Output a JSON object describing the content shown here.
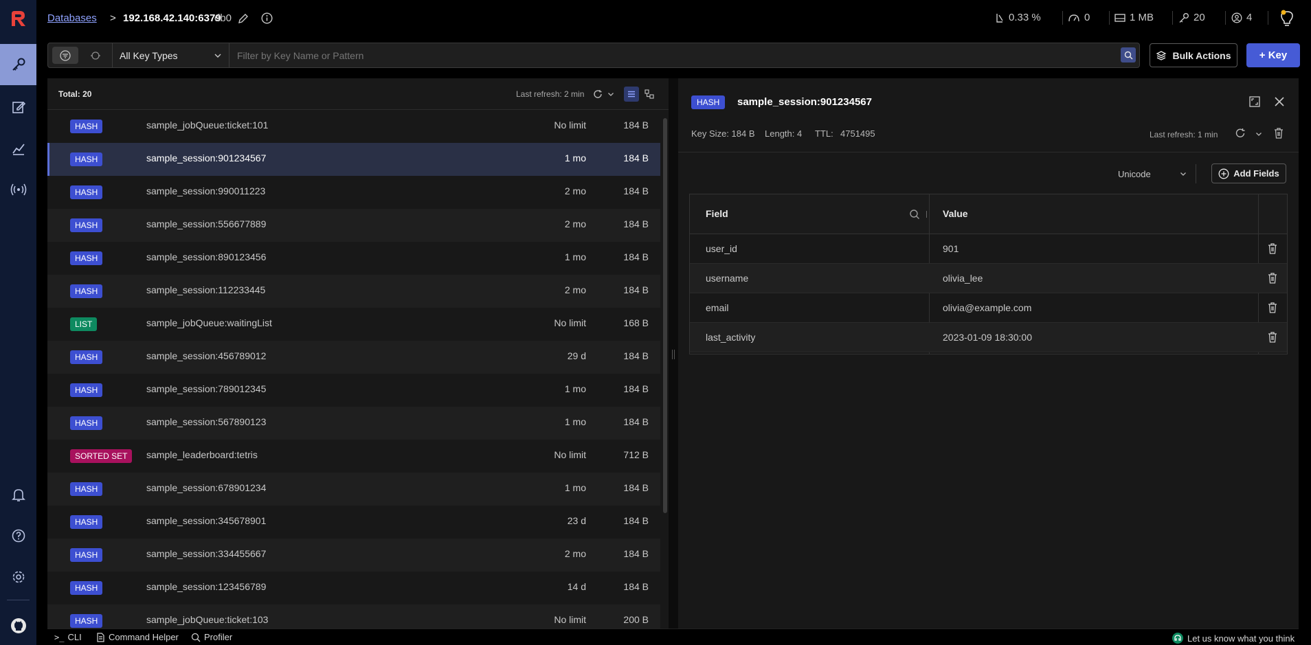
{
  "topbar": {
    "databases_link": "Databases",
    "separator": ">",
    "host": "192.168.42.140:6379",
    "db": "db0",
    "stats": {
      "cpu": "0.33 %",
      "ops": "0",
      "memory": "1 MB",
      "keys": "20",
      "clients": "4"
    }
  },
  "filter": {
    "key_type": "All Key Types",
    "search_placeholder": "Filter by Key Name or Pattern",
    "bulk_actions": "Bulk Actions",
    "add_key": "+ Key"
  },
  "keylist": {
    "total": "Total: 20",
    "last_refresh": "Last refresh: 2 min",
    "rows": [
      {
        "type": "HASH",
        "name": "sample_jobQueue:ticket:101",
        "ttl": "No limit",
        "size": "184 B"
      },
      {
        "type": "HASH",
        "name": "sample_session:901234567",
        "ttl": "1 mo",
        "size": "184 B"
      },
      {
        "type": "HASH",
        "name": "sample_session:990011223",
        "ttl": "2 mo",
        "size": "184 B"
      },
      {
        "type": "HASH",
        "name": "sample_session:556677889",
        "ttl": "2 mo",
        "size": "184 B"
      },
      {
        "type": "HASH",
        "name": "sample_session:890123456",
        "ttl": "1 mo",
        "size": "184 B"
      },
      {
        "type": "HASH",
        "name": "sample_session:112233445",
        "ttl": "2 mo",
        "size": "184 B"
      },
      {
        "type": "LIST",
        "name": "sample_jobQueue:waitingList",
        "ttl": "No limit",
        "size": "168 B"
      },
      {
        "type": "HASH",
        "name": "sample_session:456789012",
        "ttl": "29 d",
        "size": "184 B"
      },
      {
        "type": "HASH",
        "name": "sample_session:789012345",
        "ttl": "1 mo",
        "size": "184 B"
      },
      {
        "type": "HASH",
        "name": "sample_session:567890123",
        "ttl": "1 mo",
        "size": "184 B"
      },
      {
        "type": "SORTED SET",
        "name": "sample_leaderboard:tetris",
        "ttl": "No limit",
        "size": "712 B"
      },
      {
        "type": "HASH",
        "name": "sample_session:678901234",
        "ttl": "1 mo",
        "size": "184 B"
      },
      {
        "type": "HASH",
        "name": "sample_session:345678901",
        "ttl": "23 d",
        "size": "184 B"
      },
      {
        "type": "HASH",
        "name": "sample_session:334455667",
        "ttl": "2 mo",
        "size": "184 B"
      },
      {
        "type": "HASH",
        "name": "sample_session:123456789",
        "ttl": "14 d",
        "size": "184 B"
      },
      {
        "type": "HASH",
        "name": "sample_jobQueue:ticket:103",
        "ttl": "No limit",
        "size": "200 B"
      }
    ]
  },
  "details": {
    "type": "HASH",
    "key_name": "sample_session:901234567",
    "key_size": "Key Size: 184 B",
    "length": "Length: 4",
    "ttl_label": "TTL:",
    "ttl_value": "4751495",
    "last_refresh": "Last refresh: 1 min",
    "format": "Unicode",
    "add_fields": "Add Fields",
    "col_field": "Field",
    "col_value": "Value",
    "fields": [
      {
        "field": "user_id",
        "value": "901"
      },
      {
        "field": "username",
        "value": "olivia_lee"
      },
      {
        "field": "email",
        "value": "olivia@example.com"
      },
      {
        "field": "last_activity",
        "value": "2023-01-09 18:30:00"
      }
    ]
  },
  "bottombar": {
    "cli": "CLI",
    "command_helper": "Command Helper",
    "profiler": "Profiler",
    "feedback": "Let us know what you think"
  },
  "colors": {
    "hash": "#3d4fd1",
    "list": "#0e8a60",
    "sorted_set": "#a8115d",
    "accent": "#465bd6"
  }
}
